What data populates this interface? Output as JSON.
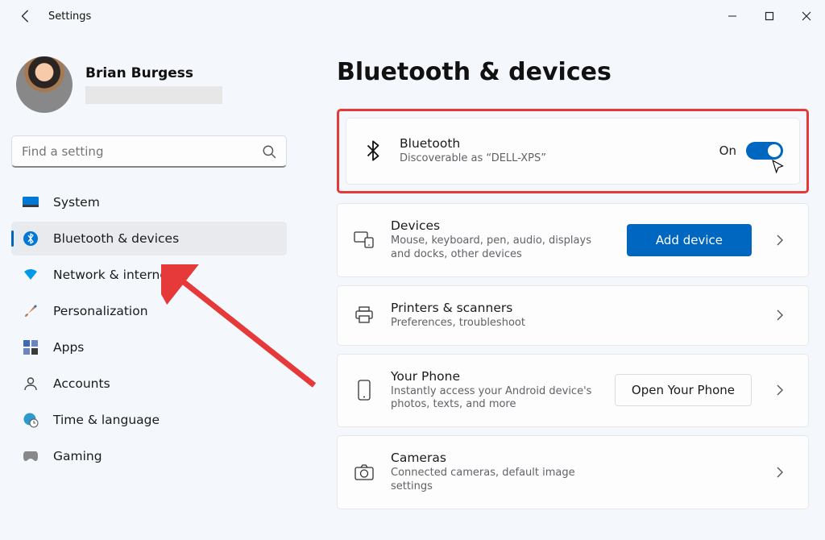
{
  "app": {
    "title": "Settings"
  },
  "profile": {
    "name": "Brian Burgess"
  },
  "search": {
    "placeholder": "Find a setting"
  },
  "sidebar": {
    "items": [
      {
        "label": "System"
      },
      {
        "label": "Bluetooth & devices"
      },
      {
        "label": "Network & internet"
      },
      {
        "label": "Personalization"
      },
      {
        "label": "Apps"
      },
      {
        "label": "Accounts"
      },
      {
        "label": "Time & language"
      },
      {
        "label": "Gaming"
      }
    ],
    "selected_index": 1
  },
  "page": {
    "title": "Bluetooth & devices",
    "bluetooth": {
      "title": "Bluetooth",
      "subtitle": "Discoverable as “DELL-XPS”",
      "state_label": "On",
      "on": true
    },
    "cards": [
      {
        "title": "Devices",
        "subtitle": "Mouse, keyboard, pen, audio, displays and docks, other devices",
        "action_label": "Add device",
        "action_primary": true
      },
      {
        "title": "Printers & scanners",
        "subtitle": "Preferences, troubleshoot"
      },
      {
        "title": "Your Phone",
        "subtitle": "Instantly access your Android device's photos, texts, and more",
        "action_label": "Open Your Phone",
        "action_primary": false
      },
      {
        "title": "Cameras",
        "subtitle": "Connected cameras, default image settings"
      }
    ]
  }
}
